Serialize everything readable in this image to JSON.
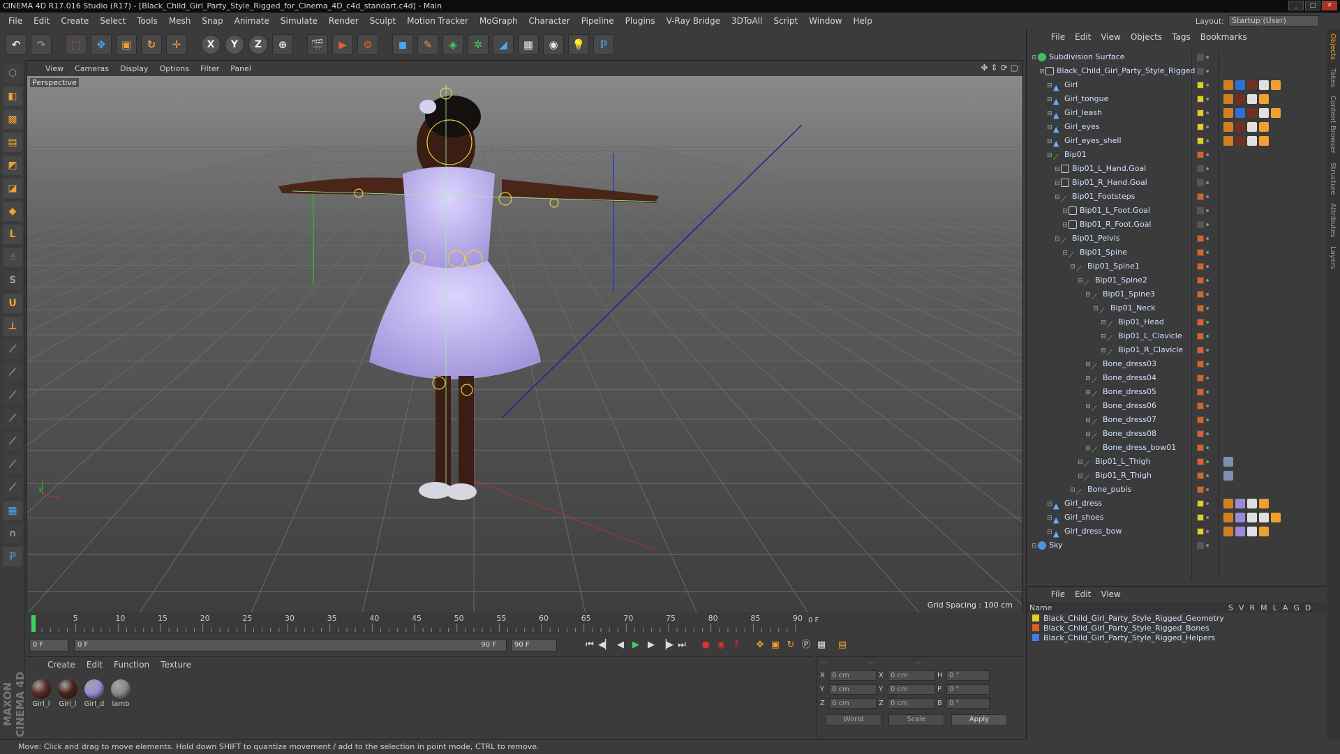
{
  "window": {
    "title": "CINEMA 4D R17.016 Studio (R17) - [Black_Child_Girl_Party_Style_Rigged_for_Cinema_4D_c4d_standart.c4d] - Main"
  },
  "menu": [
    "File",
    "Edit",
    "Create",
    "Select",
    "Tools",
    "Mesh",
    "Snap",
    "Animate",
    "Simulate",
    "Render",
    "Sculpt",
    "Motion Tracker",
    "MoGraph",
    "Character",
    "Pipeline",
    "Plugins",
    "V-Ray Bridge",
    "3DToAll",
    "Script",
    "Window",
    "Help"
  ],
  "layout": {
    "label": "Layout:",
    "value": "Startup (User)"
  },
  "viewport": {
    "menu": [
      "View",
      "Cameras",
      "Display",
      "Options",
      "Filter",
      "Panel"
    ],
    "label": "Perspective",
    "grid_spacing": "Grid Spacing : 100 cm"
  },
  "timeline": {
    "ticks": [
      "0",
      "5",
      "10",
      "15",
      "20",
      "25",
      "30",
      "35",
      "40",
      "45",
      "50",
      "55",
      "60",
      "65",
      "70",
      "75",
      "80",
      "85",
      "90"
    ],
    "current_frame": "0 F",
    "start_field": "0 F",
    "range_start": "0 F",
    "range_end": "90 F",
    "end_field": "90 F",
    "end_frame": "0 F"
  },
  "materials": {
    "menu": [
      "Create",
      "Edit",
      "Function",
      "Texture"
    ],
    "items": [
      {
        "label": "Girl_l",
        "color": "#5a2a20"
      },
      {
        "label": "Girl_l",
        "color": "#4a2218"
      },
      {
        "label": "Girl_d",
        "color": "#9b8ad8"
      },
      {
        "label": "lamb",
        "color": "#8a8a8a"
      }
    ]
  },
  "coords": {
    "rows": [
      {
        "a": "X",
        "av": "0 cm",
        "b": "X",
        "bv": "0 cm",
        "c": "H",
        "cv": "0 °"
      },
      {
        "a": "Y",
        "av": "0 cm",
        "b": "Y",
        "bv": "0 cm",
        "c": "P",
        "cv": "0 °"
      },
      {
        "a": "Z",
        "av": "0 cm",
        "b": "Z",
        "bv": "0 cm",
        "c": "B",
        "cv": "0 °"
      }
    ],
    "mode": "World",
    "scale": "Scale",
    "apply": "Apply"
  },
  "status": "Move: Click and drag to move elements. Hold down SHIFT to quantize movement / add to the selection in point mode, CTRL to remove.",
  "objects": {
    "menu": [
      "File",
      "Edit",
      "View",
      "Objects",
      "Tags",
      "Bookmarks"
    ],
    "rows": [
      {
        "name": "Subdivision Surface",
        "depth": 0,
        "icon": "subdiv",
        "color": "#555",
        "tags": []
      },
      {
        "name": "Black_Child_Girl_Party_Style_Rigged",
        "depth": 1,
        "icon": "null",
        "color": "#555",
        "tags": []
      },
      {
        "name": "Girl",
        "depth": 2,
        "icon": "poly",
        "color": "#e0d020",
        "tags": [
          "#d08020",
          "#3070d0",
          "#703020",
          "#e0e0e0",
          "#f0a030"
        ]
      },
      {
        "name": "Girl_tongue",
        "depth": 2,
        "icon": "poly",
        "color": "#e0d020",
        "tags": [
          "#d08020",
          "#703020",
          "#e0e0e0",
          "#f0a030"
        ]
      },
      {
        "name": "Girl_leash",
        "depth": 2,
        "icon": "poly",
        "color": "#e0d020",
        "tags": [
          "#d08020",
          "#3070d0",
          "#703020",
          "#e0e0e0",
          "#f0a030"
        ]
      },
      {
        "name": "Girl_eyes",
        "depth": 2,
        "icon": "poly",
        "color": "#e0d020",
        "tags": [
          "#d08020",
          "#703020",
          "#e0e0e0",
          "#f0a030"
        ]
      },
      {
        "name": "Girl_eyes_shell",
        "depth": 2,
        "icon": "poly",
        "color": "#e0d020",
        "tags": [
          "#d08020",
          "#703020",
          "#e0e0e0",
          "#f0a030"
        ]
      },
      {
        "name": "Bip01",
        "depth": 2,
        "icon": "bone",
        "color": "#e06020",
        "tags": []
      },
      {
        "name": "Bip01_L_Hand.Goal",
        "depth": 3,
        "icon": "null",
        "color": "#555",
        "tags": []
      },
      {
        "name": "Bip01_R_Hand.Goal",
        "depth": 3,
        "icon": "null",
        "color": "#555",
        "tags": []
      },
      {
        "name": "Bip01_Footsteps",
        "depth": 3,
        "icon": "bone",
        "color": "#e06020",
        "tags": []
      },
      {
        "name": "Bip01_L_Foot.Goal",
        "depth": 4,
        "icon": "null",
        "color": "#555",
        "tags": []
      },
      {
        "name": "Bip01_R_Foot.Goal",
        "depth": 4,
        "icon": "null",
        "color": "#555",
        "tags": []
      },
      {
        "name": "Bip01_Pelvis",
        "depth": 3,
        "icon": "bone",
        "color": "#e06020",
        "tags": []
      },
      {
        "name": "Bip01_Spine",
        "depth": 4,
        "icon": "bone",
        "color": "#e06020",
        "tags": []
      },
      {
        "name": "Bip01_Spine1",
        "depth": 5,
        "icon": "bone",
        "color": "#e06020",
        "tags": []
      },
      {
        "name": "Bip01_Spine2",
        "depth": 6,
        "icon": "bone",
        "color": "#e06020",
        "tags": []
      },
      {
        "name": "Bip01_Spine3",
        "depth": 7,
        "icon": "bone",
        "color": "#e06020",
        "tags": []
      },
      {
        "name": "Bip01_Neck",
        "depth": 8,
        "icon": "bone",
        "color": "#e06020",
        "tags": []
      },
      {
        "name": "Bip01_Head",
        "depth": 9,
        "icon": "bone",
        "color": "#e06020",
        "tags": []
      },
      {
        "name": "Bip01_L_Clavicle",
        "depth": 9,
        "icon": "bone",
        "color": "#e06020",
        "tags": []
      },
      {
        "name": "Bip01_R_Clavicle",
        "depth": 9,
        "icon": "bone",
        "color": "#e06020",
        "tags": []
      },
      {
        "name": "Bone_dress03",
        "depth": 7,
        "icon": "bone",
        "color": "#e06020",
        "tags": []
      },
      {
        "name": "Bone_dress04",
        "depth": 7,
        "icon": "bone",
        "color": "#e06020",
        "tags": []
      },
      {
        "name": "Bone_dress05",
        "depth": 7,
        "icon": "bone",
        "color": "#e06020",
        "tags": []
      },
      {
        "name": "Bone_dress06",
        "depth": 7,
        "icon": "bone",
        "color": "#e06020",
        "tags": []
      },
      {
        "name": "Bone_dress07",
        "depth": 7,
        "icon": "bone",
        "color": "#e06020",
        "tags": []
      },
      {
        "name": "Bone_dress08",
        "depth": 7,
        "icon": "bone",
        "color": "#e06020",
        "tags": []
      },
      {
        "name": "Bone_dress_bow01",
        "depth": 7,
        "icon": "bone",
        "color": "#e06020",
        "tags": []
      },
      {
        "name": "Bip01_L_Thigh",
        "depth": 6,
        "icon": "bone",
        "color": "#e06020",
        "tags": [
          "#8090b0"
        ]
      },
      {
        "name": "Bip01_R_Thigh",
        "depth": 6,
        "icon": "bone",
        "color": "#e06020",
        "tags": [
          "#8090b0"
        ]
      },
      {
        "name": "Bone_pubis",
        "depth": 5,
        "icon": "bone",
        "color": "#e06020",
        "tags": []
      },
      {
        "name": "Girl_dress",
        "depth": 2,
        "icon": "poly",
        "color": "#e0d020",
        "tags": [
          "#d08020",
          "#9b8ad8",
          "#e0e0e0",
          "#f0a030"
        ]
      },
      {
        "name": "Girl_shoes",
        "depth": 2,
        "icon": "poly",
        "color": "#e0d020",
        "tags": [
          "#d08020",
          "#9b8ad8",
          "#e0e0e0",
          "#e0e0e0",
          "#f0a030"
        ]
      },
      {
        "name": "Girl_dress_bow",
        "depth": 2,
        "icon": "poly",
        "color": "#e0d020",
        "tags": [
          "#d08020",
          "#9b8ad8",
          "#e0e0e0",
          "#f0a030"
        ]
      },
      {
        "name": "Sky",
        "depth": 0,
        "icon": "sky",
        "color": "#555",
        "tags": []
      }
    ]
  },
  "layers": {
    "menu": [
      "File",
      "Edit",
      "View"
    ],
    "header": {
      "name": "Name",
      "cols": [
        "S",
        "V",
        "R",
        "M",
        "L",
        "A",
        "G",
        "D"
      ]
    },
    "rows": [
      {
        "name": "Black_Child_Girl_Party_Style_Rigged_Geometry",
        "color": "#e0d020"
      },
      {
        "name": "Black_Child_Girl_Party_Style_Rigged_Bones",
        "color": "#e06020"
      },
      {
        "name": "Black_Child_Girl_Party_Style_Rigged_Helpers",
        "color": "#4080e0"
      }
    ]
  },
  "sidetabs": [
    "Objects",
    "Takes",
    "Content Browser",
    "Structure",
    "Attributes",
    "Layers"
  ]
}
